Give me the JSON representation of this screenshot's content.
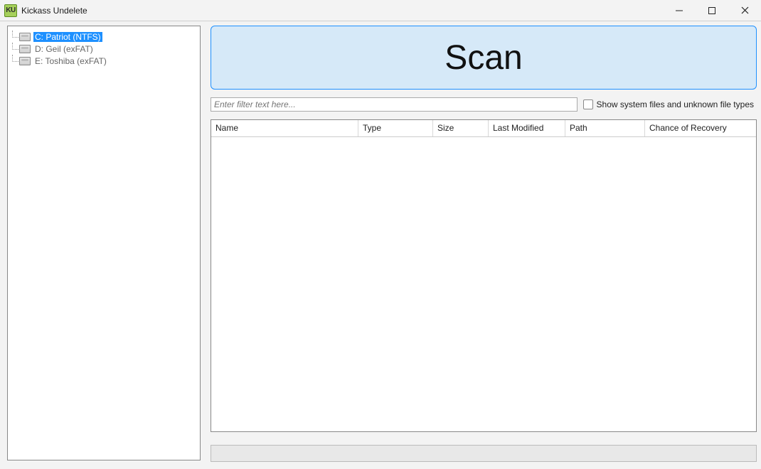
{
  "window": {
    "title": "Kickass Undelete",
    "icon_text": "KU"
  },
  "sidebar": {
    "drives": [
      {
        "label": "C: Patriot (NTFS)",
        "selected": true
      },
      {
        "label": "D: Geil (exFAT)",
        "selected": false
      },
      {
        "label": "E: Toshiba (exFAT)",
        "selected": false
      }
    ]
  },
  "main": {
    "scan_label": "Scan",
    "filter_placeholder": "Enter filter text here...",
    "show_system_label": "Show system files and unknown file types",
    "columns": {
      "name": "Name",
      "type": "Type",
      "size": "Size",
      "last_modified": "Last Modified",
      "path": "Path",
      "chance": "Chance of Recovery"
    }
  }
}
